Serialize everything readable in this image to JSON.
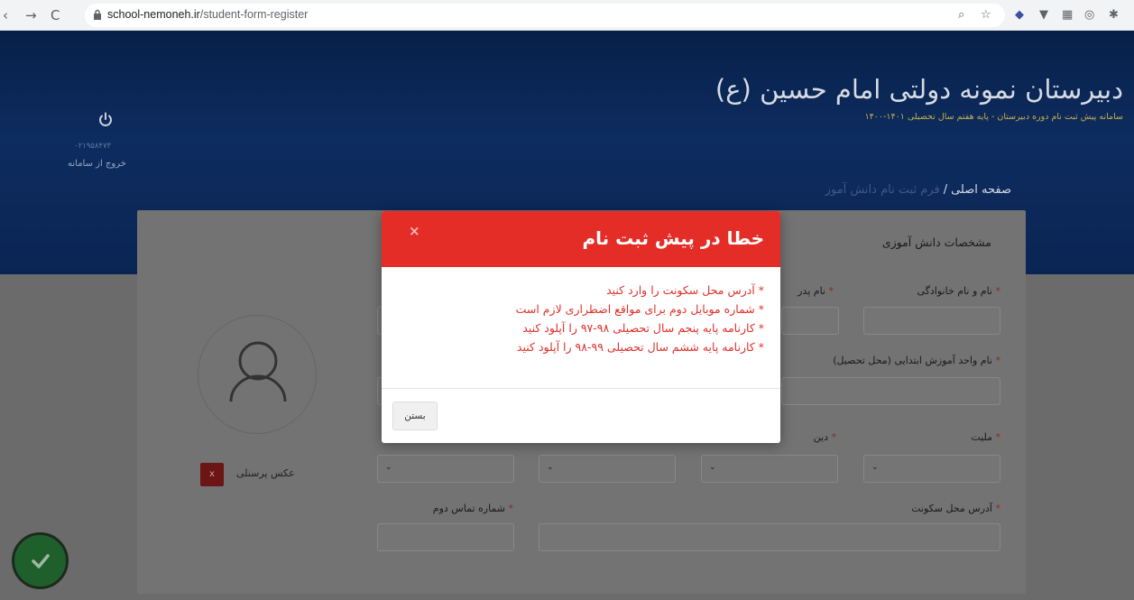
{
  "browser": {
    "url_domain": "school-nemoneh.ir",
    "url_path": "/student-form-register"
  },
  "header": {
    "school_title": "دبیرستان نمونه دولتی امام حسین (ع)",
    "subtitle": "سامانه پیش ثبت نام دوره دبیرستان - پایه هفتم سال تحصیلی ۱۴۰۱-۱۴۰۰",
    "user_code": "۰۲۱۹۵۸۴۷۳",
    "logout_label": "خروج از سامانه"
  },
  "breadcrumb": {
    "home": "صفحه اصلی",
    "separator": "/",
    "current": "فرم ثبت نام دانش آموز"
  },
  "form": {
    "section_title": "مشخصات دانش آموزی",
    "required_mark": "*",
    "labels": {
      "full_name": "نام و نام خانوادگی",
      "father_name": "نام پدر",
      "school_name": "نام واحد آموزش ابتدایی (محل تحصیل)",
      "nationality": "ملیت",
      "religion": "دین",
      "address": "آدرس محل سکونت",
      "second_phone": "شماره تماس دوم"
    },
    "photo_label": "عکس پرسنلی",
    "photo_remove": "x"
  },
  "modal": {
    "title": "خطا در پیش ثبت نام",
    "close_symbol": "×",
    "errors": [
      "* آدرس محل سکونت را وارد کنید",
      "* شماره موبایل دوم برای مواقع اضطراری لازم است",
      "* کارنامه پایه پنجم سال تحصیلی ۹۸-۹۷ را آپلود کنید",
      "* کارنامه پایه ششم سال تحصیلی ۹۹-۹۸ را آپلود کنید"
    ],
    "close_button": "بستن"
  },
  "colors": {
    "header_blue": "#0d2c5f",
    "modal_red": "#e52d27",
    "error_text": "#e0312b",
    "fab_green": "#1f5f2c"
  }
}
